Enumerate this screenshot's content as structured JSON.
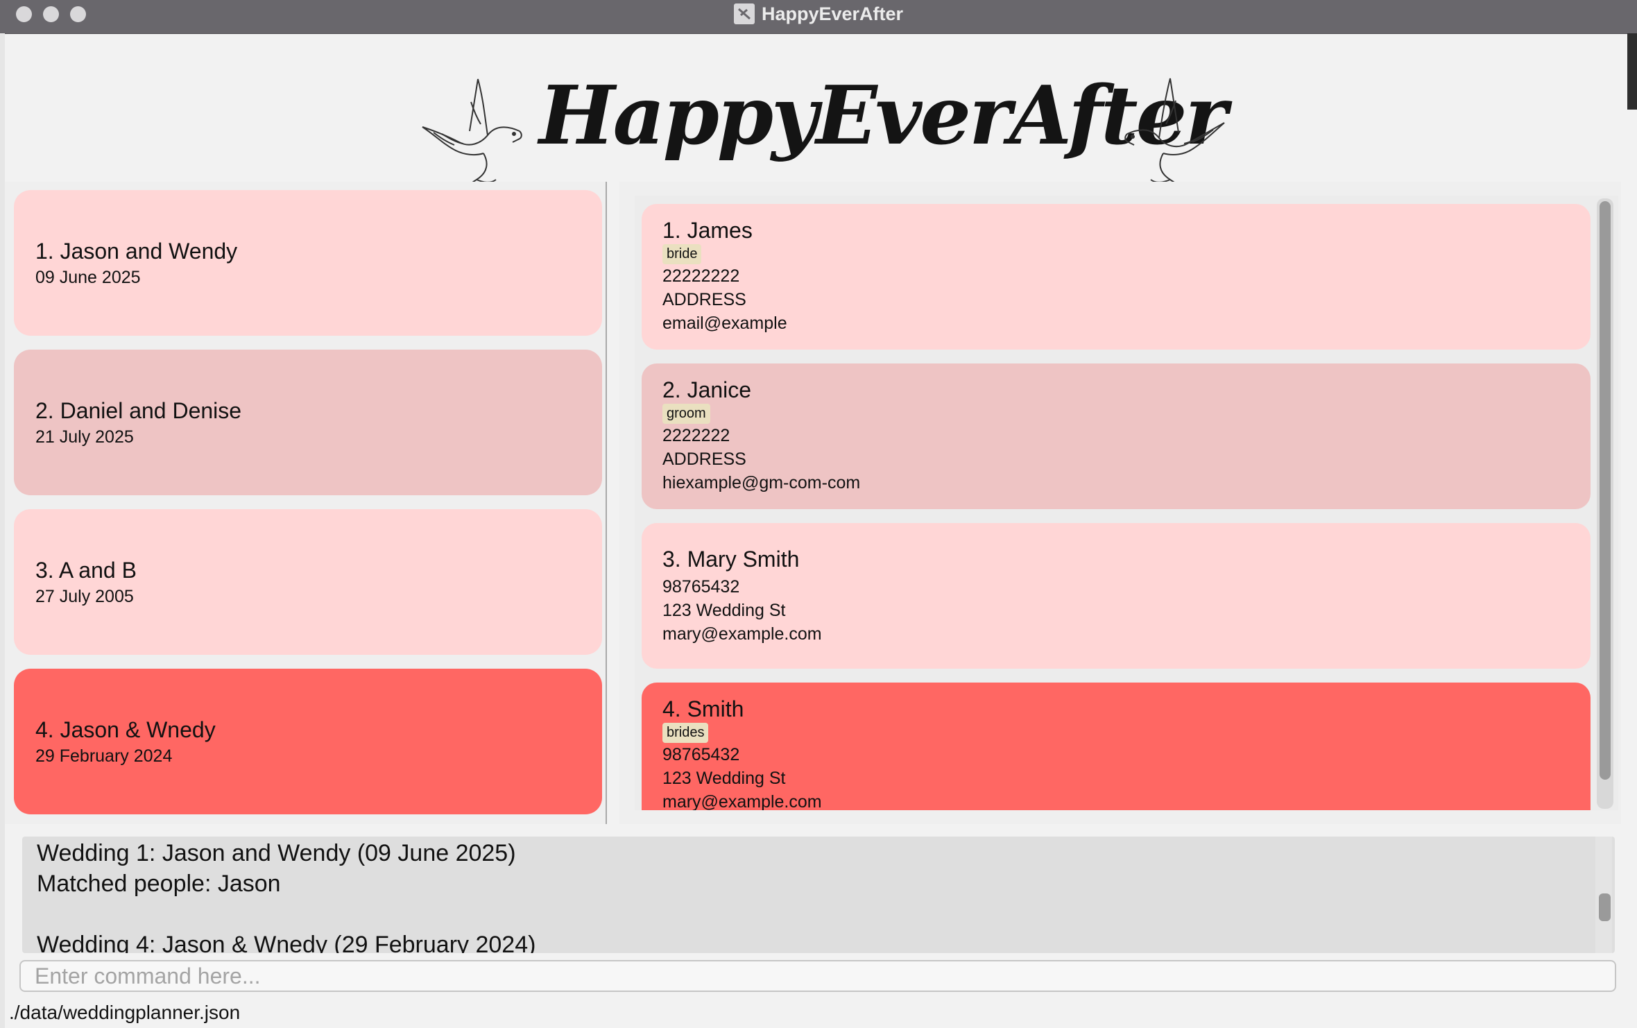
{
  "window": {
    "title": "HappyEverAfter"
  },
  "banner": {
    "logo_text": "HappyEverAfter"
  },
  "colors": {
    "card_light": "#ffd6d6",
    "card_medium": "#eec4c4",
    "card_selected": "#ff6763",
    "tag_bg": "#eae0c0"
  },
  "weddings": [
    {
      "title": "1. Jason and Wendy",
      "date": "09 June 2025"
    },
    {
      "title": "2. Daniel and Denise",
      "date": "21 July 2025"
    },
    {
      "title": "3. A and B",
      "date": "27 July 2005"
    },
    {
      "title": "4. Jason & Wnedy",
      "date": "29 February 2024"
    }
  ],
  "persons": [
    {
      "name": "1. James",
      "tag": "bride",
      "phone": "22222222",
      "address": "ADDRESS",
      "email": "email@example"
    },
    {
      "name": "2. Janice",
      "tag": "groom",
      "phone": "2222222",
      "address": "ADDRESS",
      "email": "hiexample@gm-com-com"
    },
    {
      "name": "3. Mary Smith",
      "tag": "",
      "phone": "98765432",
      "address": "123 Wedding St",
      "email": "mary@example.com"
    },
    {
      "name": "4. Smith",
      "tag": "brides",
      "phone": "98765432",
      "address": "123 Wedding St",
      "email": "mary@example.com"
    }
  ],
  "result": {
    "text": "Wedding 1: Jason and Wendy (09 June 2025)\nMatched people: Jason\n\nWedding 4: Jason & Wnedy (29 February 2024)"
  },
  "command": {
    "placeholder": "Enter command here...",
    "value": ""
  },
  "status": {
    "path": "./data/weddingplanner.json"
  }
}
